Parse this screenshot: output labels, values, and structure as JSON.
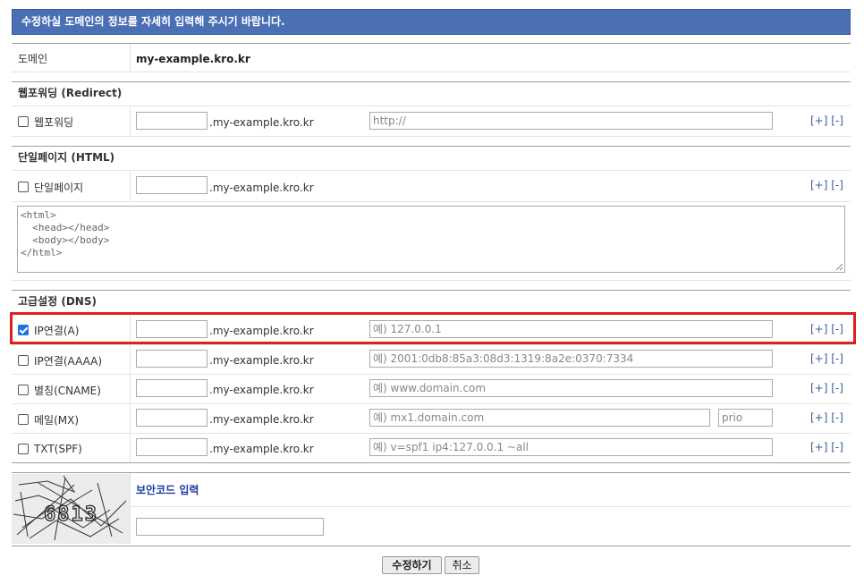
{
  "banner": "수정하실 도메인의 정보를 자세히 입력해 주시기 바랍니다.",
  "domain": {
    "label": "도메인",
    "value": "my-example.kro.kr"
  },
  "suffix": ".my-example.kro.kr",
  "pm": "[+] [-]",
  "redirect": {
    "section_title": "웹포워딩 (Redirect)",
    "checkbox_label": "웹포워딩",
    "checked": false,
    "placeholder": "http://"
  },
  "html": {
    "section_title": "단일페이지 (HTML)",
    "checkbox_label": "단일페이지",
    "checked": false,
    "textarea": "<html>\n  <head></head>\n  <body></body>\n</html>"
  },
  "dns": {
    "section_title": "고급설정 (DNS)",
    "rows": [
      {
        "label": "IP연결(A)",
        "checked": true,
        "placeholder": "예) 127.0.0.1"
      },
      {
        "label": "IP연결(AAAA)",
        "checked": false,
        "placeholder": "예) 2001:0db8:85a3:08d3:1319:8a2e:0370:7334"
      },
      {
        "label": "별칭(CNAME)",
        "checked": false,
        "placeholder": "예) www.domain.com"
      },
      {
        "label": "메일(MX)",
        "checked": false,
        "placeholder": "예) mx1.domain.com",
        "prio_placeholder": "prio"
      },
      {
        "label": "TXT(SPF)",
        "checked": false,
        "placeholder": "예) v=spf1 ip4:127.0.0.1 ~all"
      }
    ]
  },
  "captcha": {
    "title": "보안코드 입력",
    "image_text": "6813"
  },
  "buttons": {
    "submit": "수정하기",
    "cancel": "취소"
  }
}
